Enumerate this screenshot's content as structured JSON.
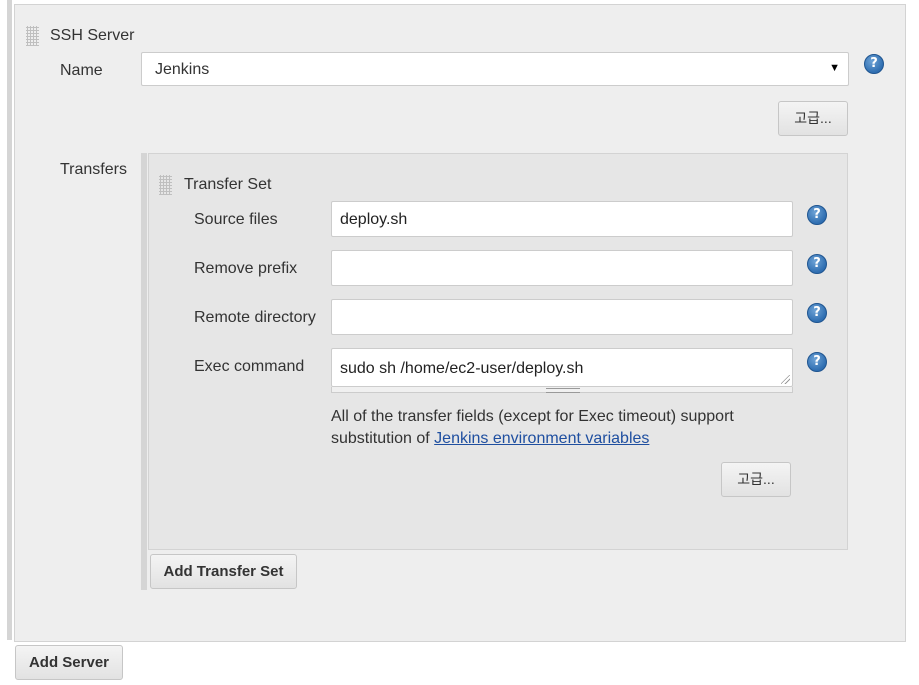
{
  "ssh_server": {
    "title": "SSH Server",
    "name_label": "Name",
    "name_value": "Jenkins",
    "advanced_label": "고급..."
  },
  "transfers": {
    "label": "Transfers",
    "transfer_set": {
      "title": "Transfer Set",
      "fields": {
        "source_files": {
          "label": "Source files",
          "value": "deploy.sh"
        },
        "remove_prefix": {
          "label": "Remove prefix",
          "value": ""
        },
        "remote_directory": {
          "label": "Remote directory",
          "value": ""
        },
        "exec_command": {
          "label": "Exec command",
          "value": "sudo sh /home/ec2-user/deploy.sh"
        }
      },
      "description_text": "All of the transfer fields (except for Exec timeout) support substitution of ",
      "description_link": "Jenkins environment variables",
      "advanced_label": "고급..."
    },
    "add_transfer_set_label": "Add Transfer Set"
  },
  "add_server_label": "Add Server",
  "help_glyph": "?",
  "icons": {
    "help": "help-icon",
    "grip": "drag-handle-icon",
    "dropdown": "chevron-down-icon"
  },
  "colors": {
    "panel_bg": "#eeeeee",
    "transfer_bg": "#e6e6e6",
    "help_blue": "#2f6eb1",
    "link": "#1f4fa0"
  }
}
